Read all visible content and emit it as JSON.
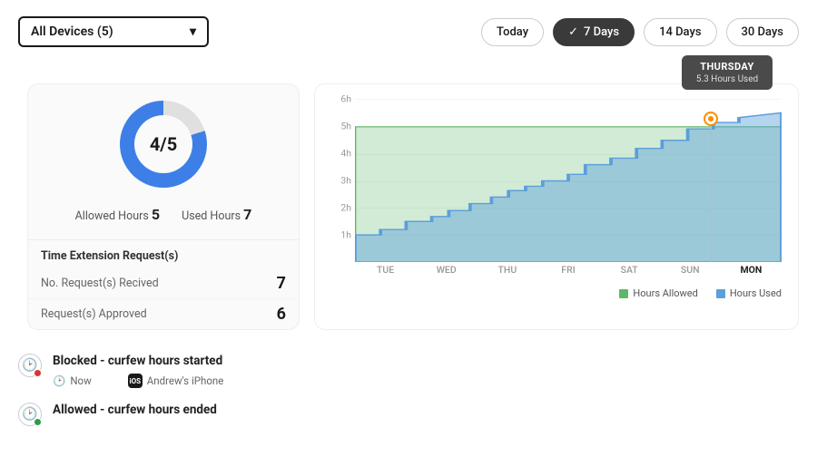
{
  "topbar": {
    "device_select_label": "All Devices (5)",
    "filters": {
      "today": "Today",
      "seven": "7 Days",
      "fourteen": "14 Days",
      "thirty": "30 Days"
    }
  },
  "summary": {
    "ratio": "4/5",
    "allowed_label": "Allowed Hours",
    "allowed_value": "5",
    "used_label": "Used Hours",
    "used_value": "7",
    "requests_title": "Time Extension Request(s)",
    "received_label": "No. Request(s) Recived",
    "received_value": "7",
    "approved_label": "Request(s) Approved",
    "approved_value": "6"
  },
  "chart": {
    "y_ticks": [
      "6h",
      "5h",
      "4h",
      "3h",
      "2h",
      "1h"
    ],
    "x_ticks": [
      "TUE",
      "WED",
      "THU",
      "FRI",
      "SAT",
      "SUN",
      "MON"
    ],
    "legend_allowed": "Hours Allowed",
    "legend_used": "Hours Used",
    "tooltip_title": "THURSDAY",
    "tooltip_sub": "5.3 Hours Used",
    "colors": {
      "allowed": "#5fb76b",
      "used": "#5b9fdb",
      "marker": "#ff8c00"
    }
  },
  "chart_data": {
    "type": "area",
    "x": [
      "TUE",
      "WED",
      "THU",
      "FRI",
      "SAT",
      "SUN",
      "MON"
    ],
    "series": [
      {
        "name": "Hours Allowed",
        "color": "#5fb76b",
        "values": [
          5,
          5,
          5,
          5,
          5,
          5,
          5
        ]
      },
      {
        "name": "Hours Used",
        "color": "#5b9fdb",
        "values": [
          1.0,
          1.9,
          2.8,
          3.6,
          4.3,
          5.1,
          5.5
        ]
      }
    ],
    "ylabel": "hours",
    "ylim": [
      0,
      6
    ],
    "highlight": {
      "xlabel": "SUN",
      "value": 5.3,
      "display_day": "THURSDAY",
      "display_text": "5.3 Hours Used"
    }
  },
  "status": {
    "blocked_title": "Blocked - curfew hours started",
    "blocked_when": "Now",
    "blocked_device": "Andrew's iPhone",
    "allowed_title": "Allowed - curfew hours ended"
  }
}
